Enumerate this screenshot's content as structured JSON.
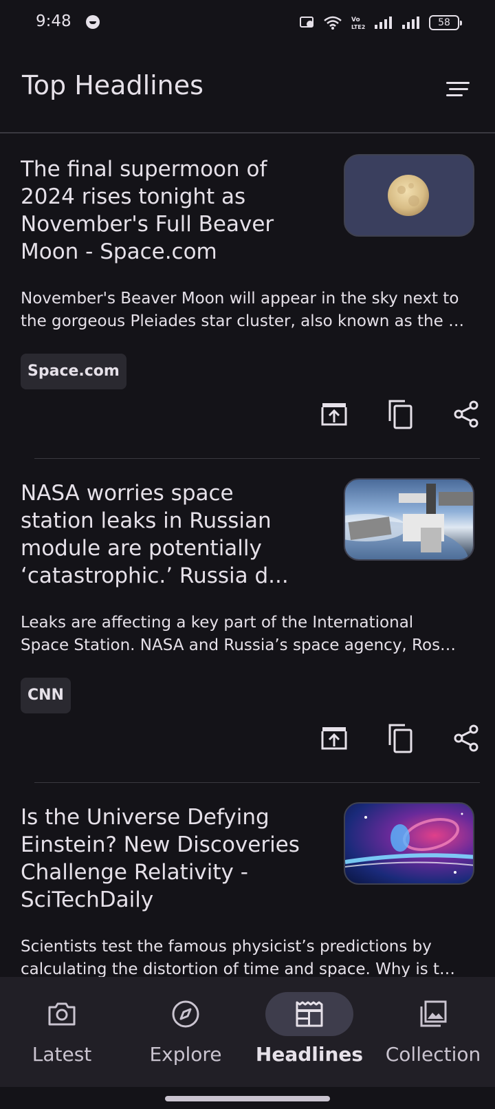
{
  "status_bar": {
    "time": "9:48",
    "battery": "58",
    "icons": [
      "face-icon",
      "cast-icon",
      "wifi-icon",
      "volte-icon",
      "signal-icon",
      "signal-icon",
      "battery-icon"
    ]
  },
  "app_bar": {
    "title": "Top Headlines",
    "sort_icon": "sort-icon"
  },
  "articles": [
    {
      "title": "The final supermoon of 2024 rises tonight as November's Full Beaver Moon - Space.com",
      "description_line1": "November's Beaver Moon will appear in the sky next to",
      "description_line2": "the gorgeous Pleiades star cluster, also known as the …",
      "source": "Space.com",
      "thumbnail": "moon-thumbnail"
    },
    {
      "title": "NASA worries space station leaks in Russian module are potentially ‘catastrophic.’ Russia d...",
      "description_line1": "Leaks are affecting a key part of the International",
      "description_line2": "Space Station. NASA and Russia’s space agency, Ros…",
      "source": "CNN",
      "thumbnail": "space-station-thumbnail"
    },
    {
      "title": "Is the Universe Defying Einstein? New Discoveries Challenge Relativity - SciTechDaily",
      "description_line1": "Scientists test the famous physicist’s predictions by",
      "description_line2": "calculating the distortion of time and space. Why is t…",
      "source": "",
      "thumbnail": "galaxy-thumbnail"
    }
  ],
  "actions": [
    "open-external-icon",
    "copy-icon",
    "share-icon"
  ],
  "nav": {
    "items": [
      {
        "label": "Latest",
        "icon": "camera-icon",
        "active": false
      },
      {
        "label": "Explore",
        "icon": "compass-icon",
        "active": false
      },
      {
        "label": "Headlines",
        "icon": "newspaper-icon",
        "active": true
      },
      {
        "label": "Collection",
        "icon": "gallery-icon",
        "active": false
      }
    ]
  },
  "colors": {
    "background": "#141318",
    "nav_background": "#211f26",
    "active_pill": "#3e3d4c",
    "chip_background": "#2a2930",
    "text": "#e6e1e9"
  }
}
